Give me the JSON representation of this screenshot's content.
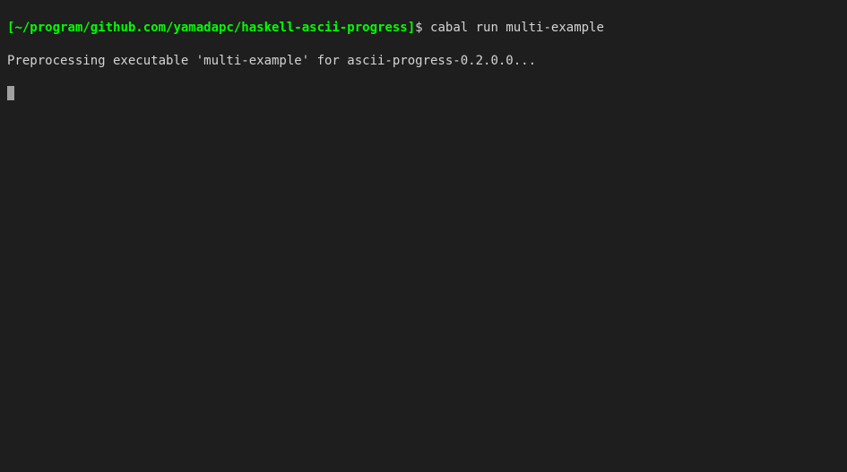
{
  "prompt": {
    "open_bracket": "[",
    "path": "~/program/github.com/yamadapc/haskell-ascii-progress",
    "close_bracket": "]",
    "dollar": "$"
  },
  "command": "cabal run multi-example",
  "output": {
    "line1": "Preprocessing executable 'multi-example' for ascii-progress-0.2.0.0..."
  }
}
